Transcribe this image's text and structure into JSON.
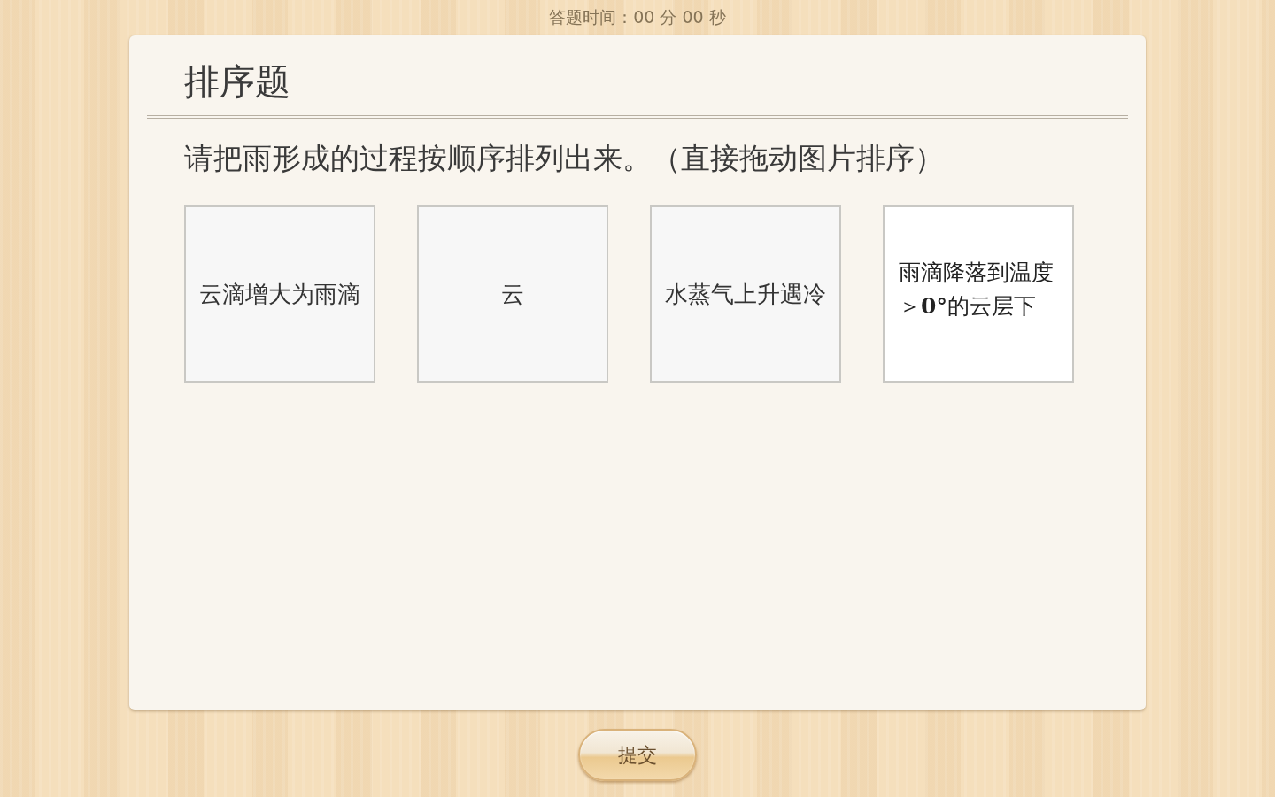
{
  "timer": {
    "text": "答题时间：00 分 00 秒"
  },
  "panel": {
    "title": "排序题",
    "instruction": "请把雨形成的过程按顺序排列出来。（直接拖动图片排序）",
    "cards": [
      {
        "text": "云滴增大为雨滴",
        "kind": "sans"
      },
      {
        "text": "云",
        "kind": "sans"
      },
      {
        "text": "水蒸气上升遇冷",
        "kind": "sans"
      },
      {
        "text": "雨滴降落到温度＞**0°**的云层下",
        "kind": "serif"
      }
    ]
  },
  "submit_button": {
    "label": "提交"
  }
}
